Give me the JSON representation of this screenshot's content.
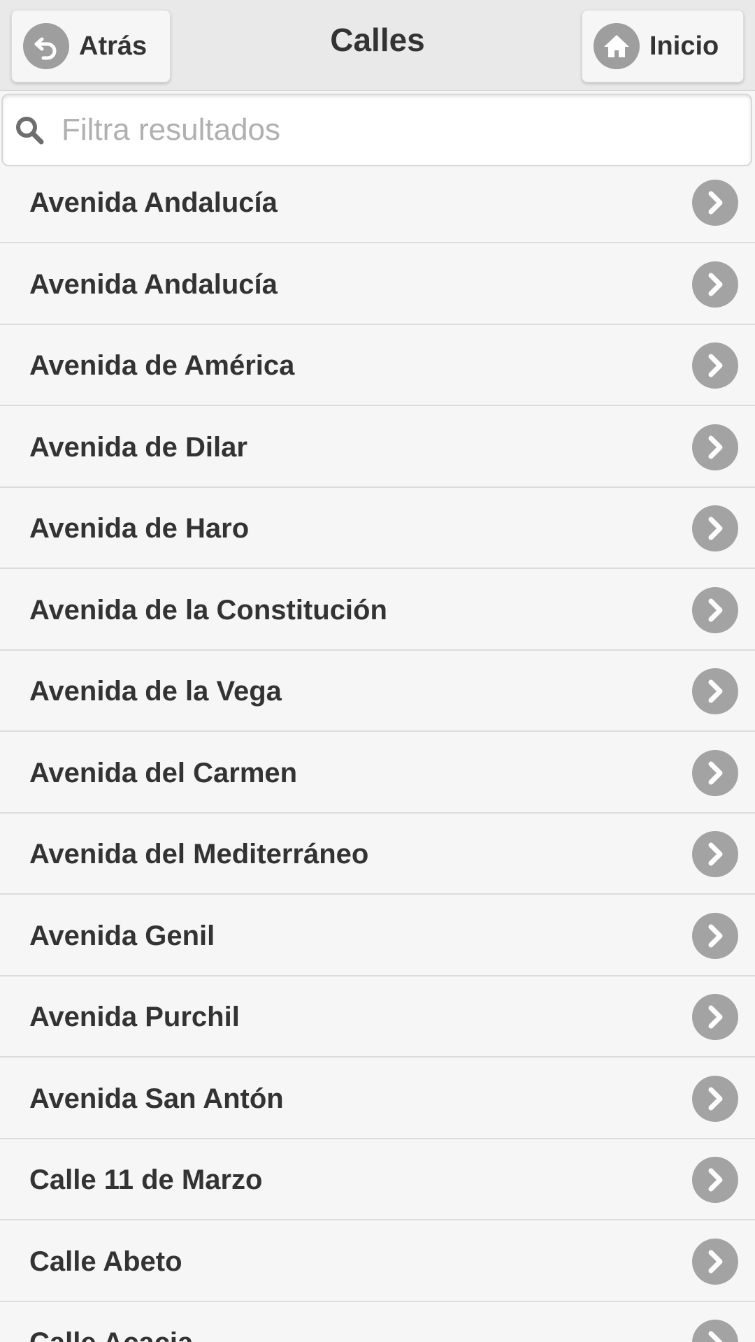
{
  "header": {
    "title": "Calles",
    "back_label": "Atrás",
    "home_label": "Inicio",
    "back_icon": "back-arrow-icon",
    "home_icon": "home-icon"
  },
  "search": {
    "placeholder": "Filtra resultados",
    "value": "",
    "icon": "search-icon"
  },
  "colors": {
    "icon_gray": "#9e9e9e",
    "text": "#333333",
    "background": "#f6f6f6",
    "header_bg": "#e9e9e9"
  },
  "streets": [
    "Avenida Andalucía",
    "Avenida Andalucía",
    "Avenida de América",
    "Avenida de Dilar",
    "Avenida de Haro",
    "Avenida de la Constitución",
    "Avenida de la Vega",
    "Avenida del Carmen",
    "Avenida del Mediterráneo",
    "Avenida Genil",
    "Avenida Purchil",
    "Avenida San Antón",
    "Calle 11 de Marzo",
    "Calle Abeto",
    "Calle Acacia"
  ]
}
